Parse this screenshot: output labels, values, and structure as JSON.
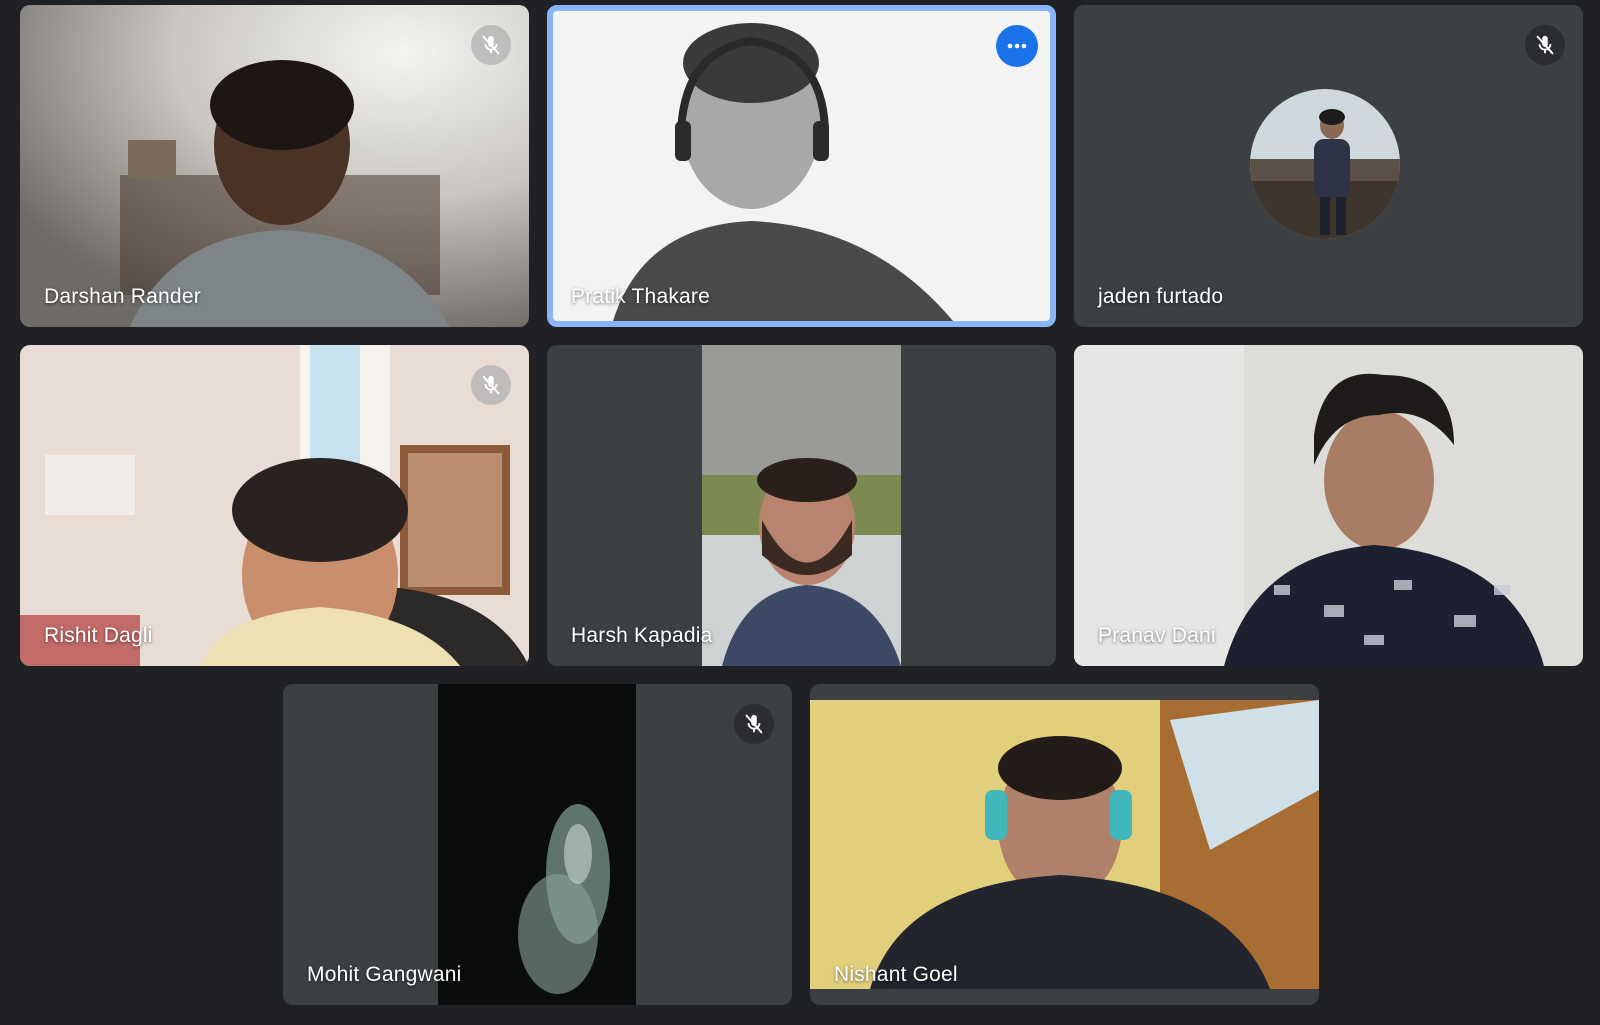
{
  "meeting": {
    "participants": [
      {
        "name": "Darshan Rander",
        "muted": true
      },
      {
        "name": "Pratik Thakare",
        "muted": false,
        "active_speaker": true,
        "more_options_icon": "more-horiz-icon"
      },
      {
        "name": "jaden furtado",
        "muted": true,
        "camera_off": true,
        "avatar_icon": "profile-photo"
      },
      {
        "name": "Rishit Dagli",
        "muted": true
      },
      {
        "name": "Harsh Kapadia",
        "muted": false
      },
      {
        "name": "Pranav Dani",
        "muted": false
      },
      {
        "name": "Mohit Gangwani",
        "muted": true
      },
      {
        "name": "Nishant Goel",
        "muted": false
      }
    ],
    "icons": {
      "mute": "mic-off-icon",
      "more": "more-horiz-icon"
    },
    "colors": {
      "background": "#202124",
      "tile": "#3c4043",
      "active_border": "#8ab4f8",
      "more_button": "#1a73e8"
    }
  }
}
